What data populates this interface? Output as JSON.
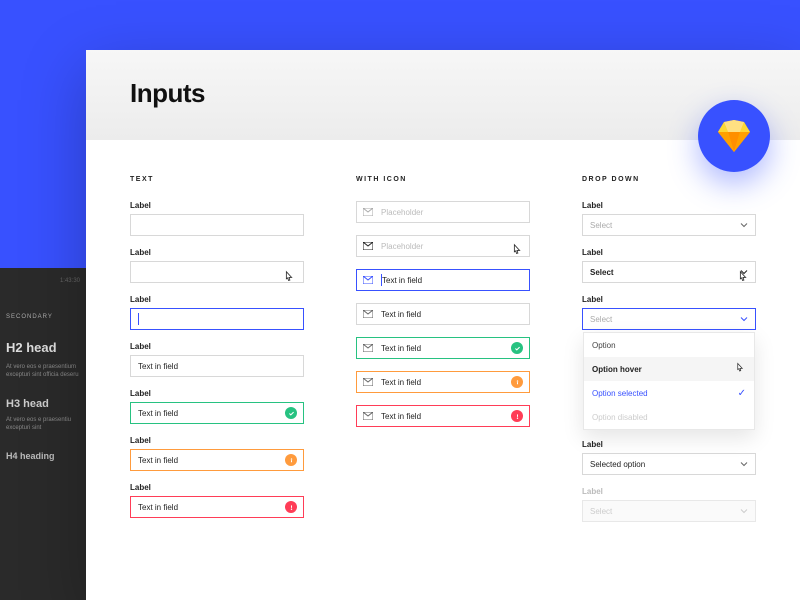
{
  "page_title": "Inputs",
  "background_panel": {
    "timestamp": "1:43:30",
    "secondary": "SECONDARY",
    "h2": "H2 head",
    "body1": "At vero eos e praesentium excepturi sint officia deseru",
    "h3": "H3 head",
    "body2": "At vero eos e praesentiu excepturi sint",
    "h4": "H4 heading"
  },
  "columns": {
    "text": {
      "title": "TEXT",
      "fields": [
        {
          "label": "Label",
          "value": "",
          "state": "default"
        },
        {
          "label": "Label",
          "value": "",
          "state": "hover"
        },
        {
          "label": "Label",
          "value": "",
          "state": "focus-caret"
        },
        {
          "label": "Label",
          "value": "Text in field",
          "state": "default"
        },
        {
          "label": "Label",
          "value": "Text in field",
          "state": "success"
        },
        {
          "label": "Label",
          "value": "Text in field",
          "state": "warning"
        },
        {
          "label": "Label",
          "value": "Text in field",
          "state": "error"
        }
      ]
    },
    "with_icon": {
      "title": "WITH ICON",
      "fields": [
        {
          "placeholder": "Placeholder",
          "state": "placeholder",
          "icon": "grey"
        },
        {
          "placeholder": "Placeholder",
          "state": "hover-placeholder",
          "icon": "black"
        },
        {
          "value": "Text in field",
          "state": "focus-caret",
          "icon": "blue"
        },
        {
          "value": "Text in field",
          "state": "default",
          "icon": "grey"
        },
        {
          "value": "Text in field",
          "state": "success",
          "icon": "grey"
        },
        {
          "value": "Text in field",
          "state": "warning",
          "icon": "grey"
        },
        {
          "value": "Text in field",
          "state": "error",
          "icon": "grey"
        }
      ]
    },
    "dropdown": {
      "title": "DROP DOWN",
      "fields": [
        {
          "label": "Label",
          "value": "Select",
          "state": "default"
        },
        {
          "label": "Label",
          "value": "Select",
          "state": "hover"
        },
        {
          "label": "Label",
          "value": "Select",
          "state": "open",
          "options": [
            {
              "text": "Option",
              "state": "normal"
            },
            {
              "text": "Option hover",
              "state": "hover"
            },
            {
              "text": "Option selected",
              "state": "selected"
            },
            {
              "text": "Option disabled",
              "state": "disabled"
            }
          ]
        },
        {
          "label": "Label",
          "value": "Selected option",
          "state": "filled"
        },
        {
          "label": "Label",
          "value": "Select",
          "state": "disabled"
        }
      ]
    }
  },
  "colors": {
    "primary": "#3851ff",
    "success": "#27c281",
    "warning": "#ff9b3d",
    "error": "#ff3d57"
  }
}
